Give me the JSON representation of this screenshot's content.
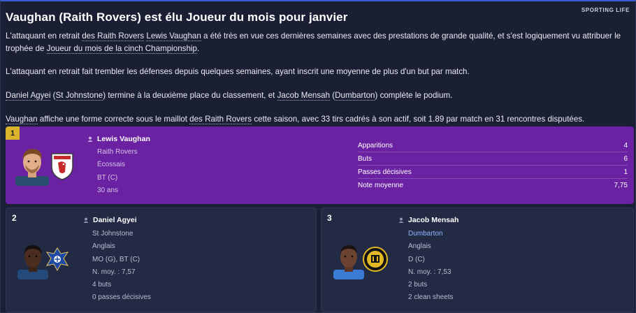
{
  "header": {
    "title": "Vaughan (Raith Rovers) est élu Joueur du mois pour janvier",
    "tag": "SPORTING LIFE"
  },
  "article": {
    "p1": {
      "a": "L'attaquant en retrait ",
      "club": "des Raith Rovers",
      "b": " ",
      "player": "Lewis Vaughan",
      "c": " a été très en vue ces dernières semaines avec des prestations de grande qualité, et s'est logiquement vu attribuer le trophée de ",
      "award": "Joueur du mois de la cinch Championship",
      "d": "."
    },
    "p2": "L'attaquant en retrait fait trembler les défenses depuis quelques semaines, ayant inscrit une moyenne de plus d'un but par match.",
    "p3": {
      "player1": "Daniel Agyei",
      "a": " (",
      "club1": "St Johnstone",
      "b": ") termine à la deuxième place du classement, et ",
      "player2": "Jacob Mensah",
      "c": " (",
      "club2": "Dumbarton",
      "d": ") complète le podium."
    },
    "p4": {
      "player": "Vaughan",
      "a": " affiche une forme correcte sous le maillot ",
      "club": "des Raith Rovers",
      "b": " cette saison, avec 33 tirs cadrés à son actif, soit 1.89 par match en 31 rencontres disputées."
    }
  },
  "winner": {
    "rank": "1",
    "name": "Lewis Vaughan",
    "club": "Raith Rovers",
    "nationality": "Écossais",
    "position": "BT (C)",
    "age": "30 ans",
    "stats": [
      {
        "label": "Apparitions",
        "value": "4"
      },
      {
        "label": "Buts",
        "value": "6"
      },
      {
        "label": "Passes décisives",
        "value": "1"
      },
      {
        "label": "Note moyenne",
        "value": "7,75"
      }
    ]
  },
  "second": {
    "rank": "2",
    "name": "Daniel Agyei",
    "club": "St Johnstone",
    "nationality": "Anglais",
    "position": "MO (G), BT (C)",
    "rating": "N. moy. : 7,57",
    "line5": "4 buts",
    "line6": "0 passes décisives"
  },
  "third": {
    "rank": "3",
    "name": "Jacob Mensah",
    "club": "Dumbarton",
    "nationality": "Anglais",
    "position": "D (C)",
    "rating": "N. moy. : 7,53",
    "line5": "2 buts",
    "line6": "2 clean sheets"
  },
  "colors": {
    "background": "#1a1f34",
    "winner_card": "#6a22a3",
    "rank_badge": "#d9b42a",
    "card": "#232a44",
    "link": "#8fb8ff"
  }
}
